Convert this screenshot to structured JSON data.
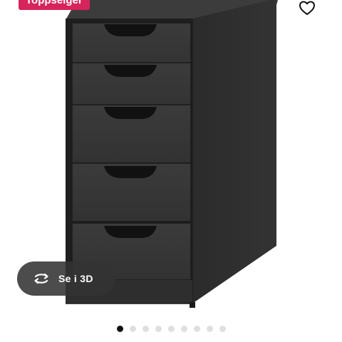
{
  "badge": {
    "label": "Toppselger",
    "color": "#d6245c"
  },
  "favorite": {
    "icon": "heart-outline-icon"
  },
  "view3d": {
    "label": "Se i 3D",
    "icon": "rotate-3d-icon"
  },
  "product": {
    "drawer_count": 5
  },
  "carousel": {
    "total_images": 9,
    "active_index": 0
  }
}
